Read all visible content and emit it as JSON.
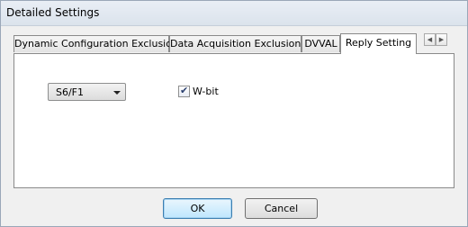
{
  "window": {
    "title": "Detailed Settings"
  },
  "tabs": [
    {
      "label": "Dynamic Configuration Exclusion"
    },
    {
      "label": "Data Acquisition Exclusion"
    },
    {
      "label": "DVVAL"
    },
    {
      "label": "Reply Setting"
    }
  ],
  "tab_scroll": {
    "left_icon": "chevron-left-icon",
    "right_icon": "chevron-right-icon",
    "left_glyph": "◀",
    "right_glyph": "▶"
  },
  "reply": {
    "message_select": {
      "value": "S6/F1"
    },
    "wbit_checkbox": {
      "label": "W-bit",
      "checked": true,
      "mark": "✔"
    }
  },
  "buttons": {
    "ok": "OK",
    "cancel": "Cancel"
  }
}
